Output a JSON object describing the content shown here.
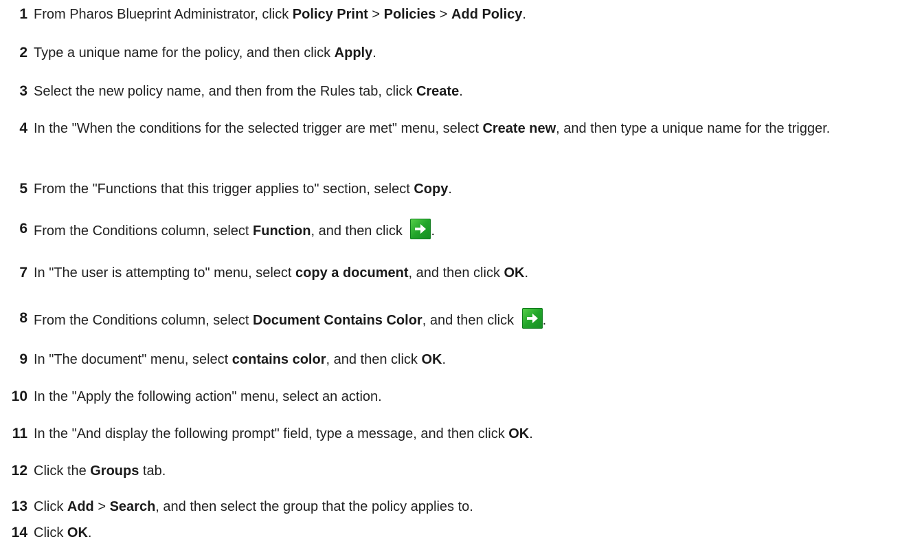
{
  "steps": [
    {
      "number": "1",
      "parts": [
        {
          "t": "From Pharos Blueprint Administrator, click "
        },
        {
          "t": "Policy Print",
          "b": true
        },
        {
          "t": " > "
        },
        {
          "t": "Policies",
          "b": true
        },
        {
          "t": " > "
        },
        {
          "t": "Add Policy",
          "b": true
        },
        {
          "t": "."
        }
      ]
    },
    {
      "number": "2",
      "parts": [
        {
          "t": "Type a unique name for the policy, and then click "
        },
        {
          "t": "Apply",
          "b": true
        },
        {
          "t": "."
        }
      ]
    },
    {
      "number": "3",
      "parts": [
        {
          "t": "Select the new policy name, and then from the Rules tab, click "
        },
        {
          "t": "Create",
          "b": true
        },
        {
          "t": "."
        }
      ]
    },
    {
      "number": "4",
      "parts": [
        {
          "t": "In the \"When the conditions for the selected trigger are met\" menu, select "
        },
        {
          "t": "Create new",
          "b": true
        },
        {
          "t": ", and then type a unique name for the trigger."
        }
      ]
    },
    {
      "number": "5",
      "parts": [
        {
          "t": "From the \"Functions that this trigger applies to\" section, select "
        },
        {
          "t": "Copy",
          "b": true
        },
        {
          "t": "."
        }
      ]
    },
    {
      "number": "6",
      "parts": [
        {
          "t": "From the Conditions column, select "
        },
        {
          "t": "Function",
          "b": true
        },
        {
          "t": ", and then click "
        },
        {
          "icon": "green-arrow-right-icon"
        },
        {
          "t": "."
        }
      ]
    },
    {
      "number": "7",
      "parts": [
        {
          "t": "In \"The user is attempting to\" menu, select "
        },
        {
          "t": "copy a document",
          "b": true
        },
        {
          "t": ", and then click "
        },
        {
          "t": "OK",
          "b": true
        },
        {
          "t": "."
        }
      ]
    },
    {
      "number": "8",
      "parts": [
        {
          "t": "From the Conditions column, select "
        },
        {
          "t": "Document Contains Color",
          "b": true
        },
        {
          "t": ", and then click "
        },
        {
          "icon": "green-arrow-right-icon"
        },
        {
          "t": "."
        }
      ]
    },
    {
      "number": "9",
      "parts": [
        {
          "t": "In \"The document\" menu, select "
        },
        {
          "t": "contains color",
          "b": true
        },
        {
          "t": ", and then click "
        },
        {
          "t": "OK",
          "b": true
        },
        {
          "t": "."
        }
      ]
    },
    {
      "number": "10",
      "parts": [
        {
          "t": "In the \"Apply the following action\" menu, select an action."
        }
      ]
    },
    {
      "number": "11",
      "parts": [
        {
          "t": "In the \"And display the following prompt\" field, type a message, and then click "
        },
        {
          "t": "OK",
          "b": true
        },
        {
          "t": "."
        }
      ]
    },
    {
      "number": "12",
      "parts": [
        {
          "t": "Click the "
        },
        {
          "t": "Groups",
          "b": true
        },
        {
          "t": " tab."
        }
      ]
    },
    {
      "number": "13",
      "parts": [
        {
          "t": "Click "
        },
        {
          "t": "Add",
          "b": true
        },
        {
          "t": " > "
        },
        {
          "t": "Search",
          "b": true
        },
        {
          "t": ", and then select the group that the policy applies to."
        }
      ]
    },
    {
      "number": "14",
      "parts": [
        {
          "t": "Click "
        },
        {
          "t": "OK",
          "b": true
        },
        {
          "t": "."
        }
      ]
    }
  ]
}
